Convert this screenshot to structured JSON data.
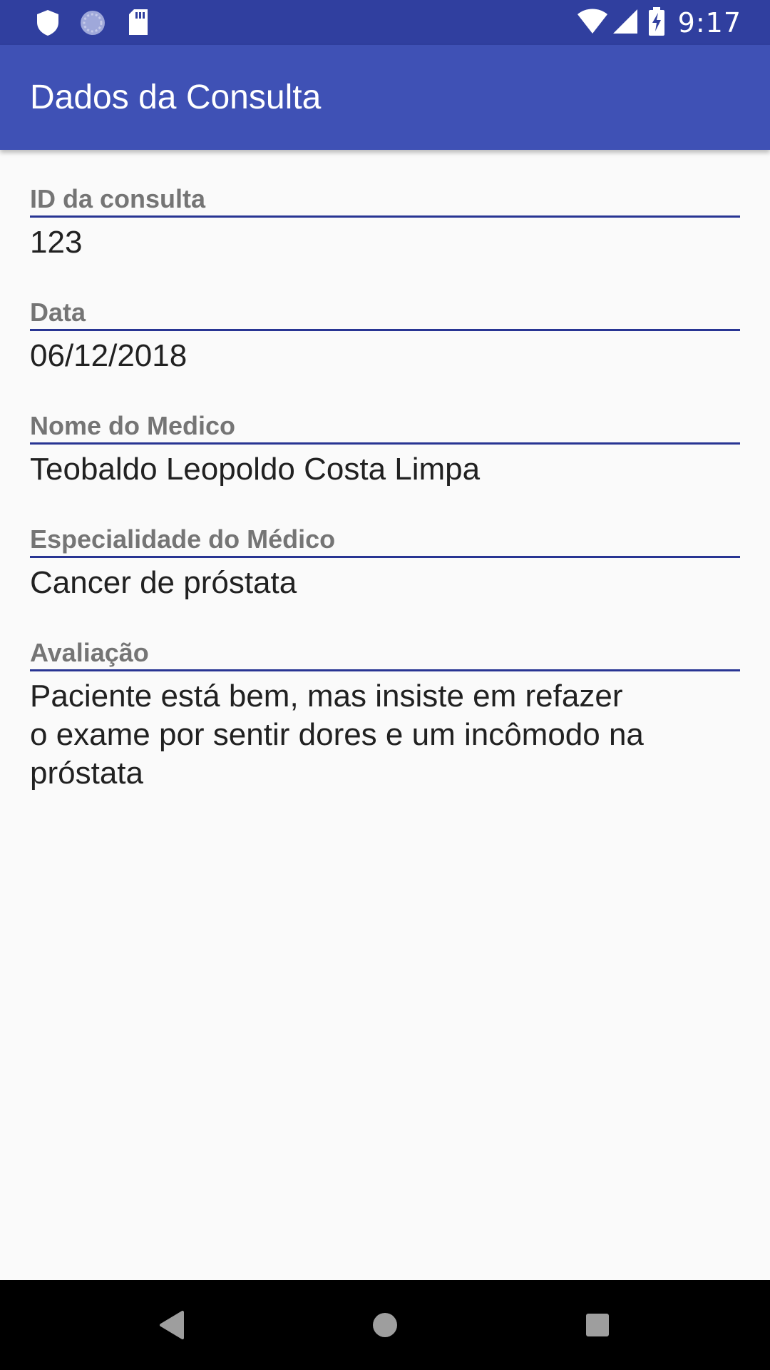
{
  "status_bar": {
    "time": "9:17",
    "icons_left": [
      "shield-icon",
      "sync-icon",
      "sd-card-icon"
    ],
    "icons_right": [
      "wifi-icon",
      "signal-icon",
      "battery-charging-icon"
    ]
  },
  "app_bar": {
    "title": "Dados da Consulta"
  },
  "fields": [
    {
      "label": "ID da consulta",
      "value": "123"
    },
    {
      "label": "Data",
      "value": "06/12/2018"
    },
    {
      "label": "Nome do Medico",
      "value": "Teobaldo Leopoldo Costa Limpa"
    },
    {
      "label": "Especialidade do Médico",
      "value": "Cancer de próstata"
    },
    {
      "label": "Avaliação",
      "value": "Paciente está bem, mas insiste em refazer\no exame por sentir dores e um incômodo na\npróstata"
    }
  ],
  "nav_bar": {
    "buttons": [
      "back-icon",
      "home-icon",
      "recents-icon"
    ]
  },
  "colors": {
    "status_bar": "#303f9f",
    "app_bar": "#3f51b5",
    "underline": "#283593",
    "label": "#757575",
    "value": "#212121",
    "background": "#fafafa"
  }
}
